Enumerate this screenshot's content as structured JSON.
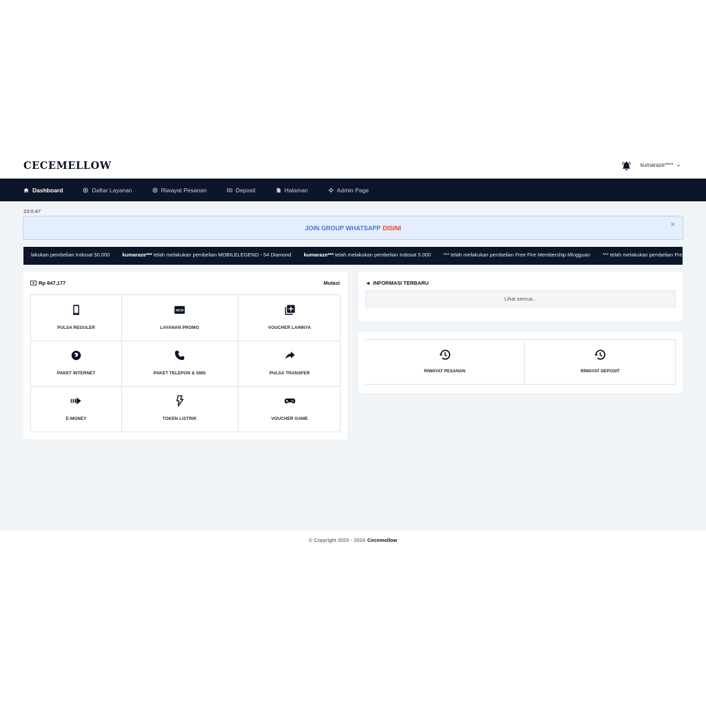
{
  "header": {
    "brand": "CECEMELLOW",
    "username": "kumaraze****"
  },
  "nav": {
    "items": [
      {
        "label": "Dashboard",
        "icon": "home-icon",
        "active": true
      },
      {
        "label": "Daftar Layanan",
        "icon": "circle-dot-icon"
      },
      {
        "label": "Riwayat Pesanan",
        "icon": "circle-dot-icon"
      },
      {
        "label": "Deposit",
        "icon": "money-icon"
      },
      {
        "label": "Halaman",
        "icon": "file-icon"
      },
      {
        "label": "Admin Page",
        "icon": "gear-icon"
      }
    ]
  },
  "clock": "23:0:47",
  "alert": {
    "text": "JOIN GROUP WHATSAPP",
    "link": "DISINI",
    "close": "×"
  },
  "ticker": {
    "items": [
      {
        "user": "",
        "text": "lakukan pembelian Indosat 50.000"
      },
      {
        "user": "kumaraze***",
        "text": " telah melakukan pembelian MOBILELEGEND - 54 Diamond"
      },
      {
        "user": "kumaraze***",
        "text": " telah melakukan pembelian Indosat 5.000"
      },
      {
        "user": "",
        "text": "*** telah melakukan pembelian Free Fire Membership Mingguan"
      },
      {
        "user": "",
        "text": "*** telah melakukan pembelian Free Fire"
      }
    ]
  },
  "balance": {
    "amount": "Rp 847,177",
    "mutasi": "Mutasi"
  },
  "services": [
    {
      "label": "PULSA REGULER",
      "icon": "phone-icon"
    },
    {
      "label": "LAYANAN PROMO",
      "icon": "new-badge-icon"
    },
    {
      "label": "VOUCHER LAINNYA",
      "icon": "add-collection-icon"
    },
    {
      "label": "PAKET INTERNET",
      "icon": "firefox-icon"
    },
    {
      "label": "PAKET TELEPON & SMS",
      "icon": "phone-call-icon"
    },
    {
      "label": "PULSA TRANSFER",
      "icon": "share-arrow-icon"
    },
    {
      "label": "E-MONEY",
      "icon": "transfer-arrow-icon"
    },
    {
      "label": "TOKEN LISTRIK",
      "icon": "lightning-icon"
    },
    {
      "label": "VOUCHER GAME",
      "icon": "gamepad-icon"
    }
  ],
  "info": {
    "title": "INFORMASI TERBARU",
    "see_all": "Lihat semua..."
  },
  "history": [
    {
      "label": "RIWAYAT PESANAN",
      "icon": "history-icon"
    },
    {
      "label": "RIWAYAT DEPOSIT",
      "icon": "history-icon"
    }
  ],
  "footer": {
    "text": "© Copyright 2020 - 2024",
    "brand": "Cecemellow"
  }
}
